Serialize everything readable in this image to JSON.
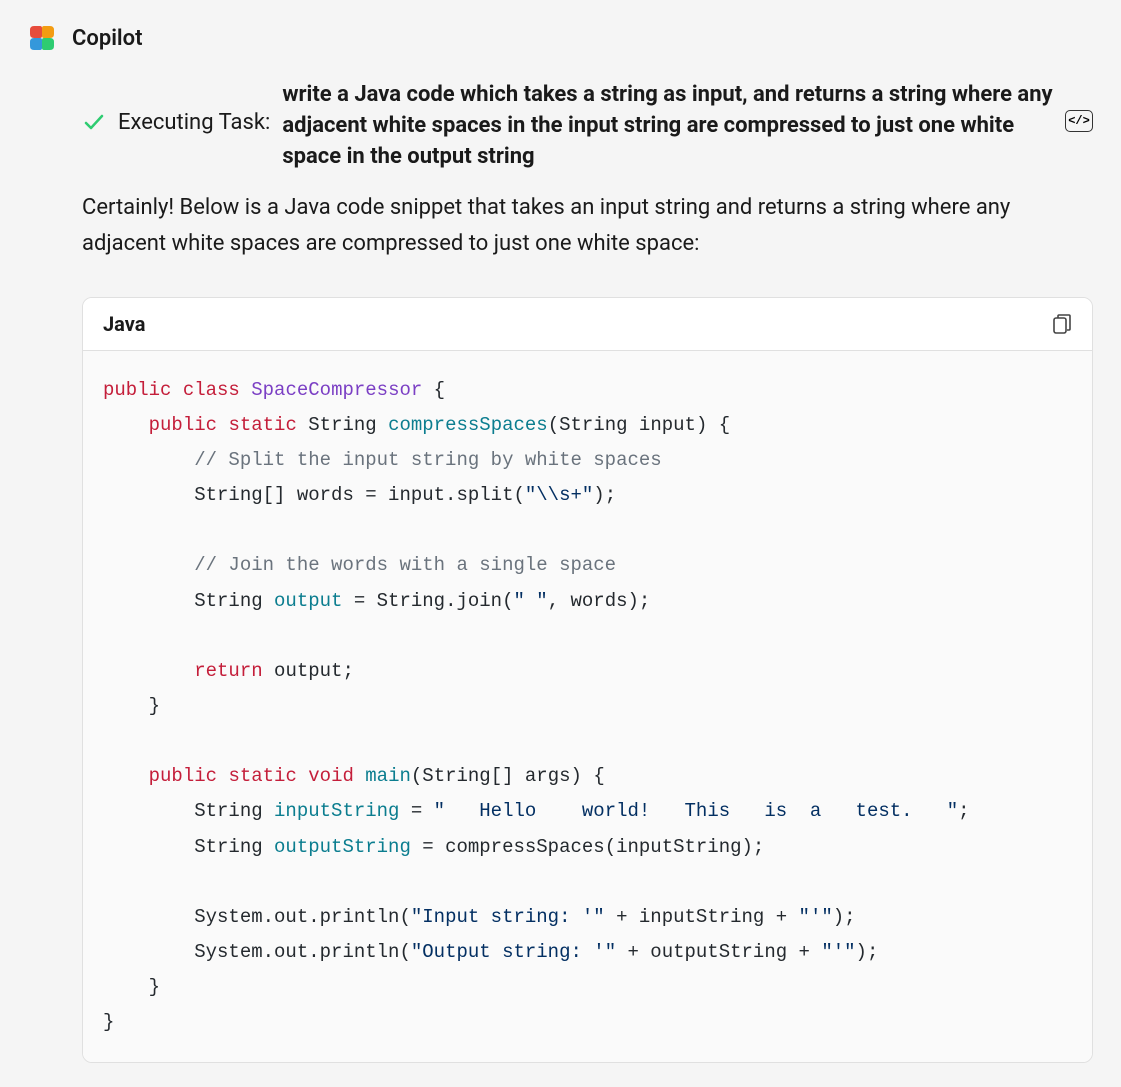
{
  "header": {
    "title": "Copilot"
  },
  "task": {
    "label": "Executing Task:",
    "description": "write a Java code which takes a string as input, and returns a string where any adjacent white spaces in the input string are compressed to just one white space in the output string",
    "action_button_label": "</>"
  },
  "response": {
    "intro_text": "Certainly! Below is a Java code snippet that takes an input string and returns a string where any adjacent white spaces are compressed to just one white space:"
  },
  "code_block": {
    "language": "Java",
    "tokens": {
      "t1": "public",
      "t2": "class",
      "t3": "SpaceCompressor",
      "t4": " {",
      "t5": "    ",
      "t6": "public",
      "t7": "static",
      "t8": " String ",
      "t9": "compressSpaces",
      "t10": "(String input) {",
      "t11": "        ",
      "t12": "// Split the input string by white spaces",
      "t13": "        String[] words = input.split(",
      "t14": "\"\\\\s+\"",
      "t15": ");",
      "t16": "        ",
      "t17": "// Join the words with a single space",
      "t18": "        String ",
      "t19": "output",
      "t20": " = String.join(",
      "t21": "\" \"",
      "t22": ", words);",
      "t23": "        ",
      "t24": "return",
      "t25": " output;",
      "t26": "    }",
      "t27": "    ",
      "t28": "public",
      "t29": "static",
      "t30": "void",
      "t31": "main",
      "t32": "(String[] args) {",
      "t33": "        String ",
      "t34": "inputString",
      "t35": " = ",
      "t36": "\"   Hello    world!   This   is  a   test.   \"",
      "t37": ";",
      "t38": "        String ",
      "t39": "outputString",
      "t40": " = compressSpaces(inputString);",
      "t41": "        System.out.println(",
      "t42": "\"Input string: '\"",
      "t43": " + inputString + ",
      "t44": "\"'\"",
      "t45": ");",
      "t46": "        System.out.println(",
      "t47": "\"Output string: '\"",
      "t48": " + outputString + ",
      "t49": "\"'\"",
      "t50": ");",
      "t51": "    }",
      "t52": "}"
    }
  }
}
